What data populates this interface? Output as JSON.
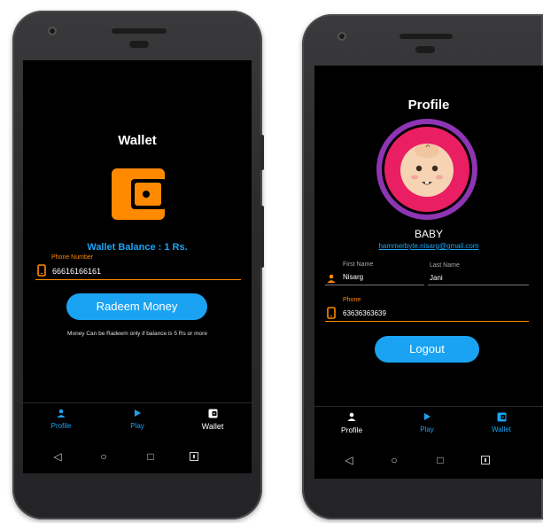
{
  "colors": {
    "accent_blue": "#1aa3f2",
    "accent_orange": "#ff8a00",
    "screen_bg": "#000000",
    "profile_ring": "#8e35b3",
    "profile_fill": "#e91e63"
  },
  "wallet_screen": {
    "title": "Wallet",
    "icon": "wallet-icon",
    "balance_text": "Wallet Balance : 1 Rs.",
    "phone_field": {
      "label": "Phone Number",
      "value": "66616166161",
      "icon": "phone-icon"
    },
    "redeem_button": "Radeem Money",
    "note": "Money Can be Radeem only if balance is 5 Rs or more",
    "nav": [
      {
        "label": "Profile",
        "icon": "person-icon",
        "active": true
      },
      {
        "label": "Play",
        "icon": "play-icon",
        "active": false
      },
      {
        "label": "Wallet",
        "icon": "wallet-icon",
        "active": false
      }
    ]
  },
  "profile_screen": {
    "title": "Profile",
    "avatar_icon": "baby-face-icon",
    "name": "BABY",
    "email": "hammerbyte.nisarg@gmail.com",
    "first_name_field": {
      "label": "First Name",
      "value": "Nisarg",
      "icon": "person-icon"
    },
    "last_name_field": {
      "label": "Last Name",
      "value": "Jani"
    },
    "phone_field": {
      "label": "Phone",
      "value": "63636363639",
      "icon": "phone-icon"
    },
    "logout_button": "Logout",
    "nav": [
      {
        "label": "Profile",
        "icon": "person-icon",
        "active": false
      },
      {
        "label": "Play",
        "icon": "play-icon",
        "active": false
      },
      {
        "label": "Wallet",
        "icon": "wallet-icon",
        "active": true
      }
    ]
  },
  "system_nav": [
    "back-icon",
    "home-icon",
    "recents-icon",
    "keyboard-icon"
  ]
}
